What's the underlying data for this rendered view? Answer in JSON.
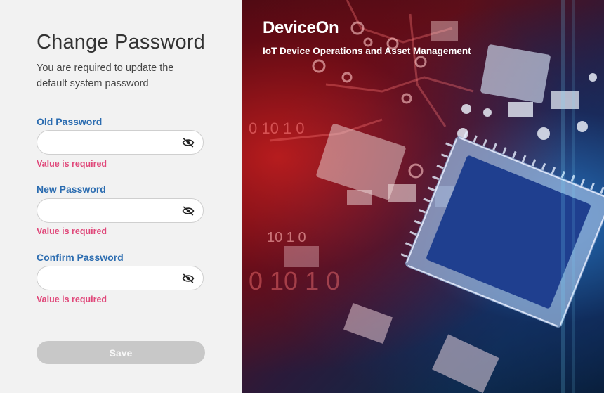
{
  "form": {
    "title": "Change Password",
    "subtitle": "You are required to update the default system password",
    "fields": [
      {
        "label": "Old Password",
        "value": "",
        "error": "Value is required"
      },
      {
        "label": "New Password",
        "value": "",
        "error": "Value is required"
      },
      {
        "label": "Confirm Password",
        "value": "",
        "error": "Value is required"
      }
    ],
    "save_label": "Save"
  },
  "hero": {
    "brand": "DeviceOn",
    "tagline": "IoT Device Operations and Asset Management",
    "binary_text": [
      "0 10 1 0",
      "10 1 0",
      "0 10 1 0"
    ]
  },
  "colors": {
    "label": "#2b6cb0",
    "error": "#e0487a",
    "button_disabled": "#c8c8c8"
  },
  "icons": {
    "field_toggle": "eye-off-icon"
  }
}
